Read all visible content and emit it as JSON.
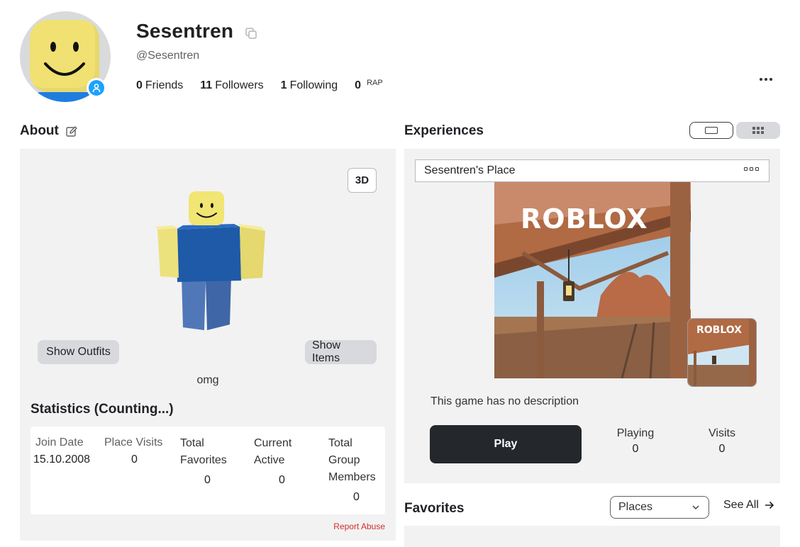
{
  "profile": {
    "display_name": "Sesentren",
    "username": "@Sesentren",
    "friends_count": "0",
    "friends_label": "Friends",
    "followers_count": "11",
    "followers_label": "Followers",
    "following_count": "1",
    "following_label": "Following",
    "rap_value": "0",
    "rap_label": "RAP",
    "presence_color": "#1aa1ff"
  },
  "about": {
    "title": "About",
    "btn_3d": "3D",
    "show_outfits": "Show Outfits",
    "show_items": "Show Items",
    "blurb": "omg",
    "stats_title": "Statistics (Counting...)",
    "stats": {
      "join_date_label": "Join Date",
      "join_date_value": "15.10.2008",
      "place_visits_label": "Place Visits",
      "place_visits_value": "0",
      "total_favorites_label_1": "Total",
      "total_favorites_label_2": "Favorites",
      "total_favorites_value": "0",
      "current_active_label_1": "Current",
      "current_active_label_2": "Active",
      "current_active_value": "0",
      "group_members_label_1": "Total",
      "group_members_label_2": "Group",
      "group_members_label_3": "Members",
      "group_members_value": "0"
    },
    "report_abuse": "Report Abuse"
  },
  "experiences": {
    "title": "Experiences",
    "game_name": "Sesentren's Place",
    "logo_text_main": "ROBLOX",
    "logo_text_small": "ROBLOX",
    "description": "This game has no description",
    "play_label": "Play",
    "playing_label": "Playing",
    "playing_value": "0",
    "visits_label": "Visits",
    "visits_value": "0"
  },
  "favorites": {
    "title": "Favorites",
    "selected_option": "Places",
    "see_all": "See All"
  },
  "colors": {
    "primary_text": "#1f2125",
    "panel_bg": "#f2f2f3",
    "play_button": "#24272c",
    "report_abuse": "#d22f2f"
  },
  "icons": [
    "copy-icon",
    "edit-icon",
    "more-icon",
    "view-list-icon",
    "view-grid-icon",
    "chevron-down-icon",
    "arrow-right-icon",
    "presence-icon"
  ]
}
